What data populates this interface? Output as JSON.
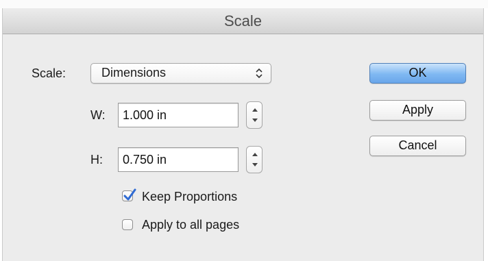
{
  "dialog": {
    "title": "Scale",
    "scale_label": "Scale:",
    "scale_popup_value": "Dimensions",
    "width_label": "W:",
    "width_value": "1.000 in",
    "height_label": "H:",
    "height_value": "0.750 in",
    "keep_proportions_label": "Keep Proportions",
    "keep_proportions_checked": true,
    "apply_all_label": "Apply to all pages",
    "apply_all_checked": false
  },
  "buttons": {
    "ok": "OK",
    "apply": "Apply",
    "cancel": "Cancel"
  },
  "colors": {
    "default_button": "#7fb8f2",
    "checkmark": "#2f6bd3"
  },
  "icons": {
    "popup_arrows": "updown-chevrons-icon",
    "stepper": "stepper-arrows-icon",
    "check": "checkmark-icon"
  }
}
